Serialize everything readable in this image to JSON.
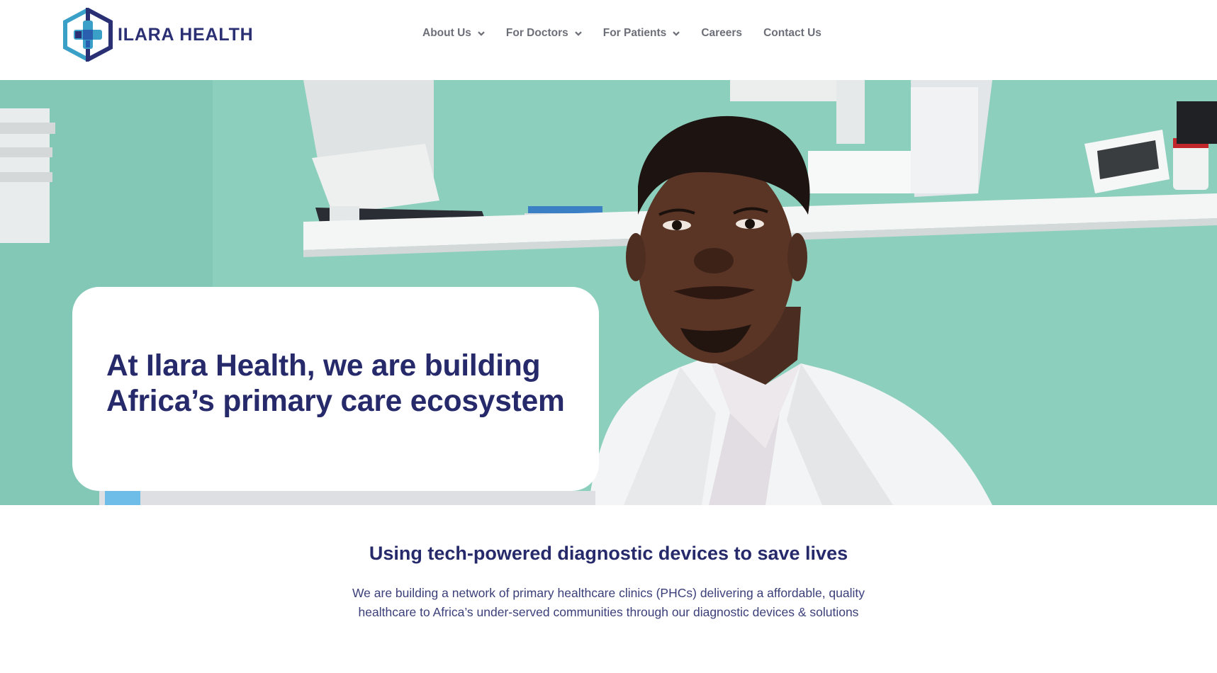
{
  "brand": {
    "name": "ILARA HEALTH",
    "logo_icon": "hexagon-cross-logo-icon",
    "colors": {
      "navy": "#2b2f73",
      "teal": "#3aa0c8",
      "blue": "#2a5fb0",
      "nav_text": "#6c6f78",
      "wall_green": "#8ccfbc"
    }
  },
  "nav": {
    "items": [
      {
        "label": "About Us",
        "has_dropdown": true,
        "icon": "chevron-down-icon"
      },
      {
        "label": "For Doctors",
        "has_dropdown": true,
        "icon": "chevron-down-icon"
      },
      {
        "label": "For Patients",
        "has_dropdown": true,
        "icon": "chevron-down-icon"
      },
      {
        "label": "Careers",
        "has_dropdown": false
      },
      {
        "label": "Contact Us",
        "has_dropdown": false
      }
    ]
  },
  "hero": {
    "title_line1": "At Ilara Health, we are building",
    "title_line2": "Africa’s primary care ecosystem"
  },
  "intro": {
    "title": "Using tech-powered diagnostic devices to save lives",
    "text_line1": "We are building a network of primary healthcare clinics (PHCs) delivering a affordable, quality",
    "text_line2": "healthcare to Africa’s under-served communities through our diagnostic devices & solutions"
  }
}
